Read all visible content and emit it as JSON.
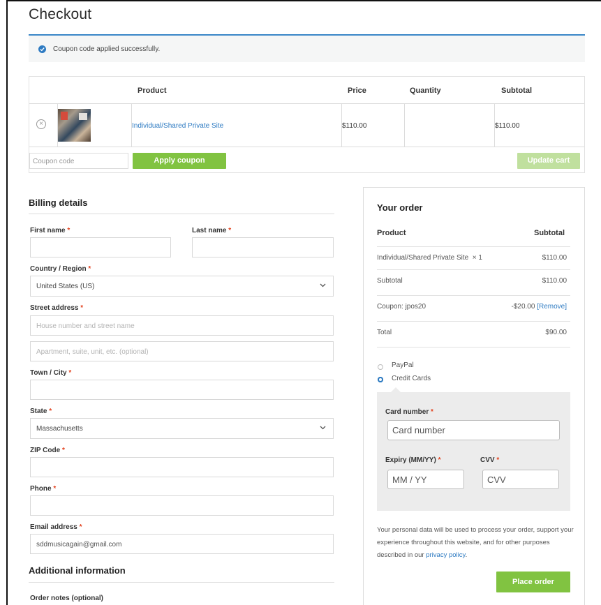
{
  "page": {
    "title": "Checkout"
  },
  "notice": {
    "text": "Coupon code applied successfully.",
    "icon": "check-circle-icon"
  },
  "cart": {
    "headers": {
      "product": "Product",
      "price": "Price",
      "quantity": "Quantity",
      "subtotal": "Subtotal"
    },
    "rows": [
      {
        "name": "Individual/Shared Private Site",
        "price": "$110.00",
        "quantity": "",
        "subtotal": "$110.00"
      }
    ],
    "coupon_placeholder": "Coupon code",
    "apply_coupon_label": "Apply coupon",
    "update_cart_label": "Update cart"
  },
  "billing": {
    "title": "Billing details",
    "required_mark": "*",
    "fields": {
      "first_name": {
        "label": "First name",
        "value": ""
      },
      "last_name": {
        "label": "Last name",
        "value": ""
      },
      "country": {
        "label": "Country / Region",
        "value": "United States (US)"
      },
      "street": {
        "label": "Street address",
        "placeholder1": "House number and street name",
        "placeholder2": "Apartment, suite, unit, etc. (optional)"
      },
      "city": {
        "label": "Town / City",
        "value": ""
      },
      "state": {
        "label": "State",
        "value": "Massachusetts"
      },
      "zip": {
        "label": "ZIP Code",
        "value": ""
      },
      "phone": {
        "label": "Phone",
        "value": ""
      },
      "email": {
        "label": "Email address",
        "value": "sddmusicagain@gmail.com"
      }
    }
  },
  "additional": {
    "title": "Additional information",
    "notes_label": "Order notes (optional)"
  },
  "order": {
    "title": "Your order",
    "head_product": "Product",
    "head_subtotal": "Subtotal",
    "item_name": "Individual/Shared Private Site",
    "item_qty": "× 1",
    "item_total": "$110.00",
    "subtotal_label": "Subtotal",
    "subtotal_value": "$110.00",
    "coupon_label": "Coupon: jpos20",
    "coupon_value": "-$20.00",
    "coupon_remove": "[Remove]",
    "total_label": "Total",
    "total_value": "$90.00",
    "payment_methods": [
      {
        "label": "PayPal",
        "selected": false
      },
      {
        "label": "Credit Cards",
        "selected": true
      }
    ],
    "card": {
      "number_label": "Card number",
      "number_placeholder": "Card number",
      "expiry_label": "Expiry (MM/YY)",
      "expiry_placeholder": "MM / YY",
      "cvv_label": "CVV",
      "cvv_placeholder": "CVV"
    },
    "privacy_text": "Your personal data will be used to process your order, support your experience throughout this website, and for other purposes described in our ",
    "privacy_link": "privacy policy",
    "privacy_end": ".",
    "place_order_label": "Place order"
  },
  "colors": {
    "accent": "#2e7bc2",
    "button": "#81c341",
    "required": "#e2401c"
  }
}
